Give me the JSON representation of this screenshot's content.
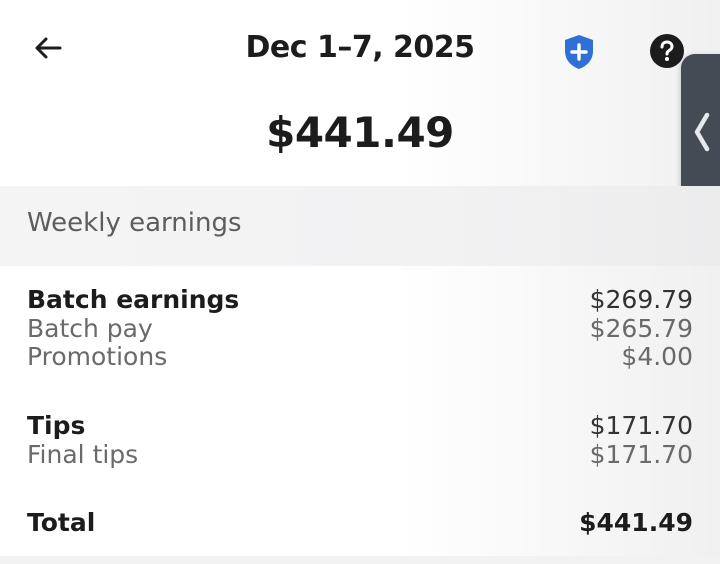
{
  "header": {
    "title": "Dec 1–7, 2025",
    "back_icon": "arrow-left-icon",
    "shield_icon": "shield-plus-icon",
    "help_icon": "question-circle-icon"
  },
  "total_amount": "$441.49",
  "section": {
    "title": "Weekly earnings"
  },
  "earnings": {
    "batch": {
      "label": "Batch earnings",
      "value": "$269.79",
      "items": [
        {
          "label": "Batch pay",
          "value": "$265.79"
        },
        {
          "label": "Promotions",
          "value": "$4.00"
        }
      ]
    },
    "tips": {
      "label": "Tips",
      "value": "$171.70",
      "items": [
        {
          "label": "Final tips",
          "value": "$171.70"
        }
      ]
    },
    "total": {
      "label": "Total",
      "value": "$441.49"
    }
  },
  "colors": {
    "shield": "#2f6fd6",
    "handle": "#454b55",
    "section_bg": "#f4f4f5"
  }
}
